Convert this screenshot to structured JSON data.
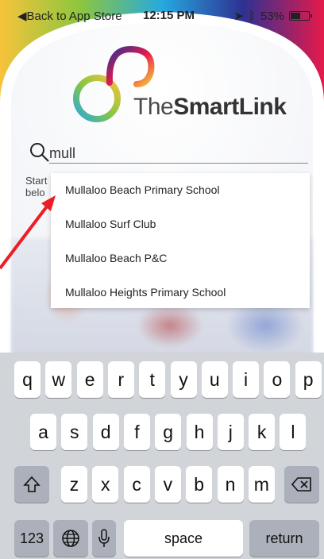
{
  "status_bar": {
    "back_label": "◀Back to App Store",
    "time": "12:15 PM",
    "battery": "53%"
  },
  "brand": {
    "name_light": "The",
    "name_bold": "SmartLink"
  },
  "search": {
    "value": "mull",
    "icon": "search-icon"
  },
  "hint": {
    "text": "Start belo"
  },
  "suggestions": [
    "Mullaloo Beach Primary School",
    "Mullaloo Surf Club",
    "Mullaloo Beach P&C",
    "Mullaloo Heights Primary School"
  ],
  "annotation": {
    "arrow_color": "#ee1c24"
  },
  "keyboard": {
    "row1": [
      "q",
      "w",
      "e",
      "r",
      "t",
      "y",
      "u",
      "i",
      "o",
      "p"
    ],
    "row2": [
      "a",
      "s",
      "d",
      "f",
      "g",
      "h",
      "j",
      "k",
      "l"
    ],
    "row3": [
      "z",
      "x",
      "c",
      "v",
      "b",
      "n",
      "m"
    ],
    "numbers_label": "123",
    "space_label": "space",
    "return_label": "return",
    "shift_icon": "shift-icon",
    "delete_icon": "delete-icon",
    "globe_icon": "globe-icon",
    "mic_icon": "microphone-icon"
  }
}
